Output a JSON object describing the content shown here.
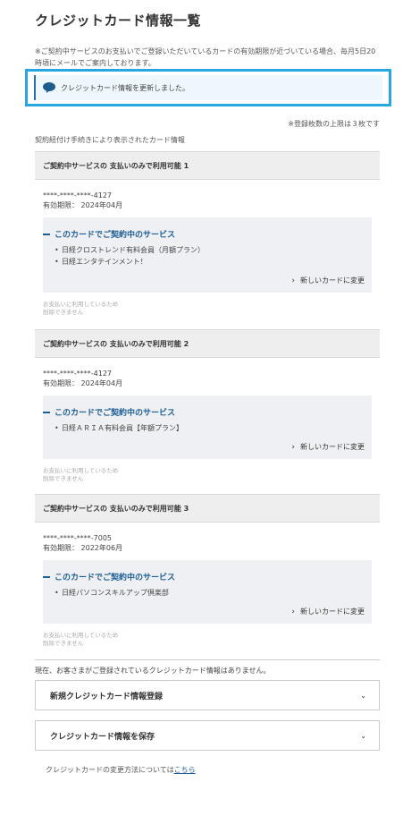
{
  "page": {
    "title": "クレジットカード情報一覧",
    "notice": "※ご契約中サービスのお支払いでご登録いただいているカードの有効期限が近づいている場合、毎月5日20時頃にメールでご案内しております。"
  },
  "flash": {
    "message": "クレジットカード情報を更新しました。",
    "icon": "speech-bubble-icon"
  },
  "limit_note": "※登録枚数の上限は３枚です",
  "linked_label": "契約紐付け手続きにより表示されたカード情報",
  "cards": [
    {
      "header": "ご契約中サービスの 支払いのみで利用可能 1",
      "number": "****-****-****-4127",
      "expiry": "有効期限： 2024年04月",
      "services_title": "このカードでご契約中のサービス",
      "services": [
        "日経クロストレンド有料会員（月額プラン）",
        "日経エンタテインメント！"
      ],
      "change_label": "新しいカードに変更",
      "cannot_delete": [
        "お支払いに利用しているため",
        "削除できません"
      ]
    },
    {
      "header": "ご契約中サービスの 支払いのみで利用可能 2",
      "number": "****-****-****-4127",
      "expiry": "有効期限： 2024年04月",
      "services_title": "このカードでご契約中のサービス",
      "services": [
        "日経ＡＲＩＡ有料会員【年額プラン】"
      ],
      "change_label": "新しいカードに変更",
      "cannot_delete": [
        "お支払いに利用しているため",
        "削除できません"
      ]
    },
    {
      "header": "ご契約中サービスの 支払いのみで利用可能 3",
      "number": "****-****-****-7005",
      "expiry": "有効期限： 2022年06月",
      "services_title": "このカードでご契約中のサービス",
      "services": [
        "日経パソコンスキルアップ倶楽部"
      ],
      "change_label": "新しいカードに変更",
      "cannot_delete": [
        "お支払いに利用しているため",
        "削除できません"
      ]
    }
  ],
  "no_card_note": "現在、お客さまがご登録されているクレジットカード情報はありません。",
  "accordions": [
    {
      "label": "新規クレジットカード情報登録"
    },
    {
      "label": "クレジットカード情報を保存"
    }
  ],
  "change_method": {
    "text": "クレジットカードの変更方法については",
    "link": "こちら"
  },
  "colors": {
    "accent": "#1f5f95",
    "highlight_border": "#27a7e0",
    "header_bg": "#eeeeee",
    "service_bg": "#eef0f3"
  }
}
